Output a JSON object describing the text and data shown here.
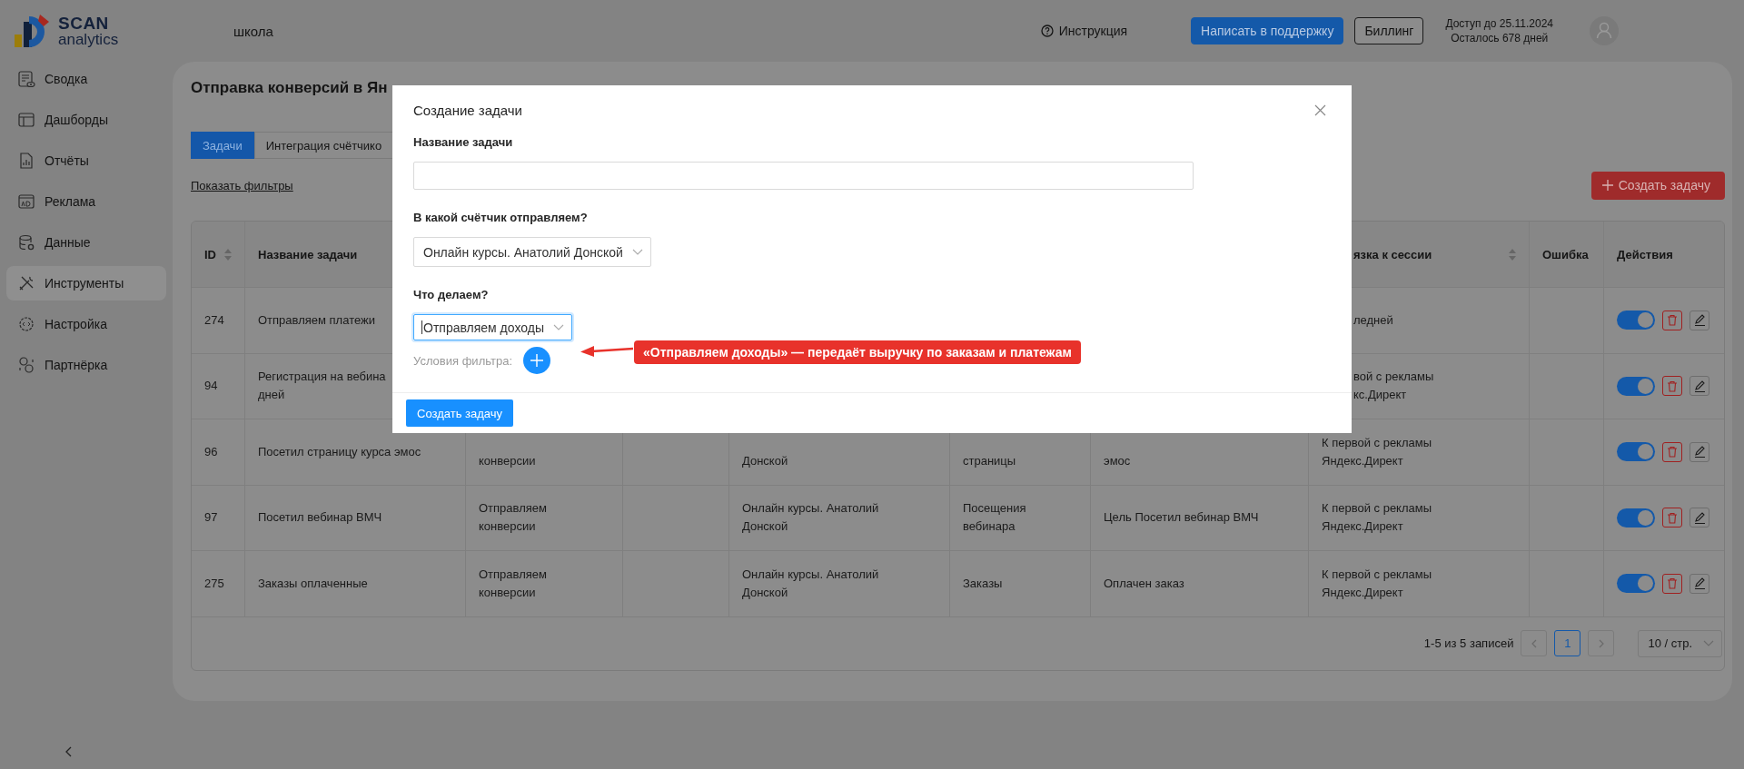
{
  "logo": {
    "name": "SCAN",
    "subtitle": "analytics"
  },
  "sidebar": {
    "items": [
      {
        "label": "Сводка",
        "selected": false
      },
      {
        "label": "Дашборды",
        "selected": false
      },
      {
        "label": "Отчёты",
        "selected": false
      },
      {
        "label": "Реклама",
        "selected": false
      },
      {
        "label": "Данные",
        "selected": false
      },
      {
        "label": "Инструменты",
        "selected": true
      },
      {
        "label": "Настройка",
        "selected": false
      },
      {
        "label": "Партнёрка",
        "selected": false
      }
    ]
  },
  "header": {
    "project": "школа",
    "help": "Инструкция",
    "support_button": "Написать в поддержку",
    "billing_button": "Биллинг",
    "access_until": "Доступ до 25.11.2024",
    "days_left": "Осталось 678 дней"
  },
  "page": {
    "title": "Отправка конверсий в Ян",
    "tabs": [
      {
        "label": "Задачи",
        "selected": true
      },
      {
        "label": "Интеграция счётчико",
        "selected": false
      }
    ],
    "filters_link": "Показать фильтры",
    "create_button": "Создать задачу"
  },
  "table": {
    "columns": [
      {
        "label": "ID",
        "sortable": true
      },
      {
        "label": "Название задачи",
        "sortable": false
      },
      {
        "label": "язка к сессии",
        "sortable": true
      },
      {
        "label": "Ошибка",
        "sortable": false
      },
      {
        "label": "Действия",
        "sortable": false
      }
    ],
    "rows": [
      {
        "id": "274",
        "task_name": [
          "Отправляем платежи"
        ],
        "column_8": [
          "ледней"
        ],
        "active": true
      },
      {
        "id": "94",
        "task_name": [
          "Регистрация на вебина",
          "дней"
        ],
        "column_8": [
          "вой с рекламы",
          "кс.Директ"
        ],
        "active": true
      },
      {
        "id": "96",
        "task_name": [
          "Посетил страницу курса эмос"
        ],
        "column_3": [
          "конверсии"
        ],
        "column_5": [
          "Донской"
        ],
        "column_6": [
          "страницы"
        ],
        "column_7": [
          "эмос"
        ],
        "column_8": [
          "К первой с рекламы",
          "Яндекс.Директ"
        ],
        "active": true
      },
      {
        "id": "97",
        "task_name": [
          "Посетил вебинар ВМЧ"
        ],
        "column_3": [
          "Отправляем",
          "конверсии"
        ],
        "column_5": [
          "Онлайн курсы. Анатолий",
          "Донской"
        ],
        "column_6": [
          "Посещения вебинара"
        ],
        "column_7": [
          "Цель Посетил вебинар ВМЧ"
        ],
        "column_8": [
          "К первой с рекламы",
          "Яндекс.Директ"
        ],
        "active": true
      },
      {
        "id": "275",
        "task_name": [
          "Заказы оплаченные"
        ],
        "column_3": [
          "Отправляем",
          "конверсии"
        ],
        "column_5": [
          "Онлайн курсы. Анатолий",
          "Донской"
        ],
        "column_6": [
          "Заказы"
        ],
        "column_7": [
          "Оплачен заказ"
        ],
        "column_8": [
          "К первой с рекламы",
          "Яндекс.Директ"
        ],
        "active": true
      }
    ],
    "pagination": {
      "summary": "1-5 из 5 записей",
      "pages": [
        {
          "label": "1",
          "selected": true
        }
      ],
      "page_size": "10 / стр."
    }
  },
  "modal": {
    "title": "Создание задачи",
    "fields": [
      {
        "kind": "text",
        "label": "Название задачи",
        "focused": false
      },
      {
        "kind": "select",
        "label": "В какой счётчик отправляем?",
        "value": "Онлайн курсы. Анатолий Донской",
        "focused": false
      },
      {
        "kind": "select",
        "label": "Что делаем?",
        "value": "Отправляем доходы",
        "focused": true
      }
    ],
    "filter_label": "Условия фильтра:",
    "submit_button": "Создать задачу",
    "callout": "«Отправляем доходы» — передаёт выручку по заказам и платежам"
  }
}
